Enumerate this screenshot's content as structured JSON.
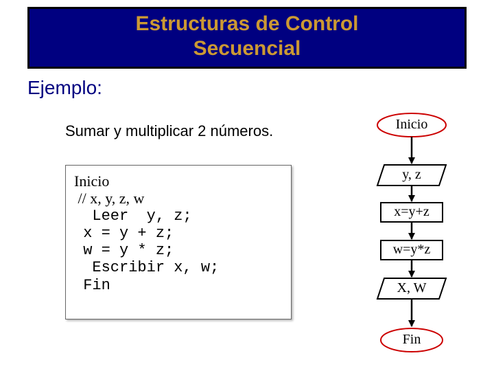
{
  "title": {
    "line1": "Estructuras de Control",
    "line2": "Secuencial"
  },
  "example_label": "Ejemplo:",
  "subtitle": "Sumar y multiplicar 2 números.",
  "code": {
    "l1": "Inicio",
    "l2": " // x, y, z, w",
    "l3": "  Leer  y, z;",
    "l4": " x = y + z;",
    "l5": " w = y * z;",
    "l6": "  Escribir x, w;",
    "l7": " Fin"
  },
  "flow": {
    "start": "Inicio",
    "input": "y, z",
    "step1": "x=y+z",
    "step2": "w=y*z",
    "output": "X, W",
    "end": "Fin"
  }
}
